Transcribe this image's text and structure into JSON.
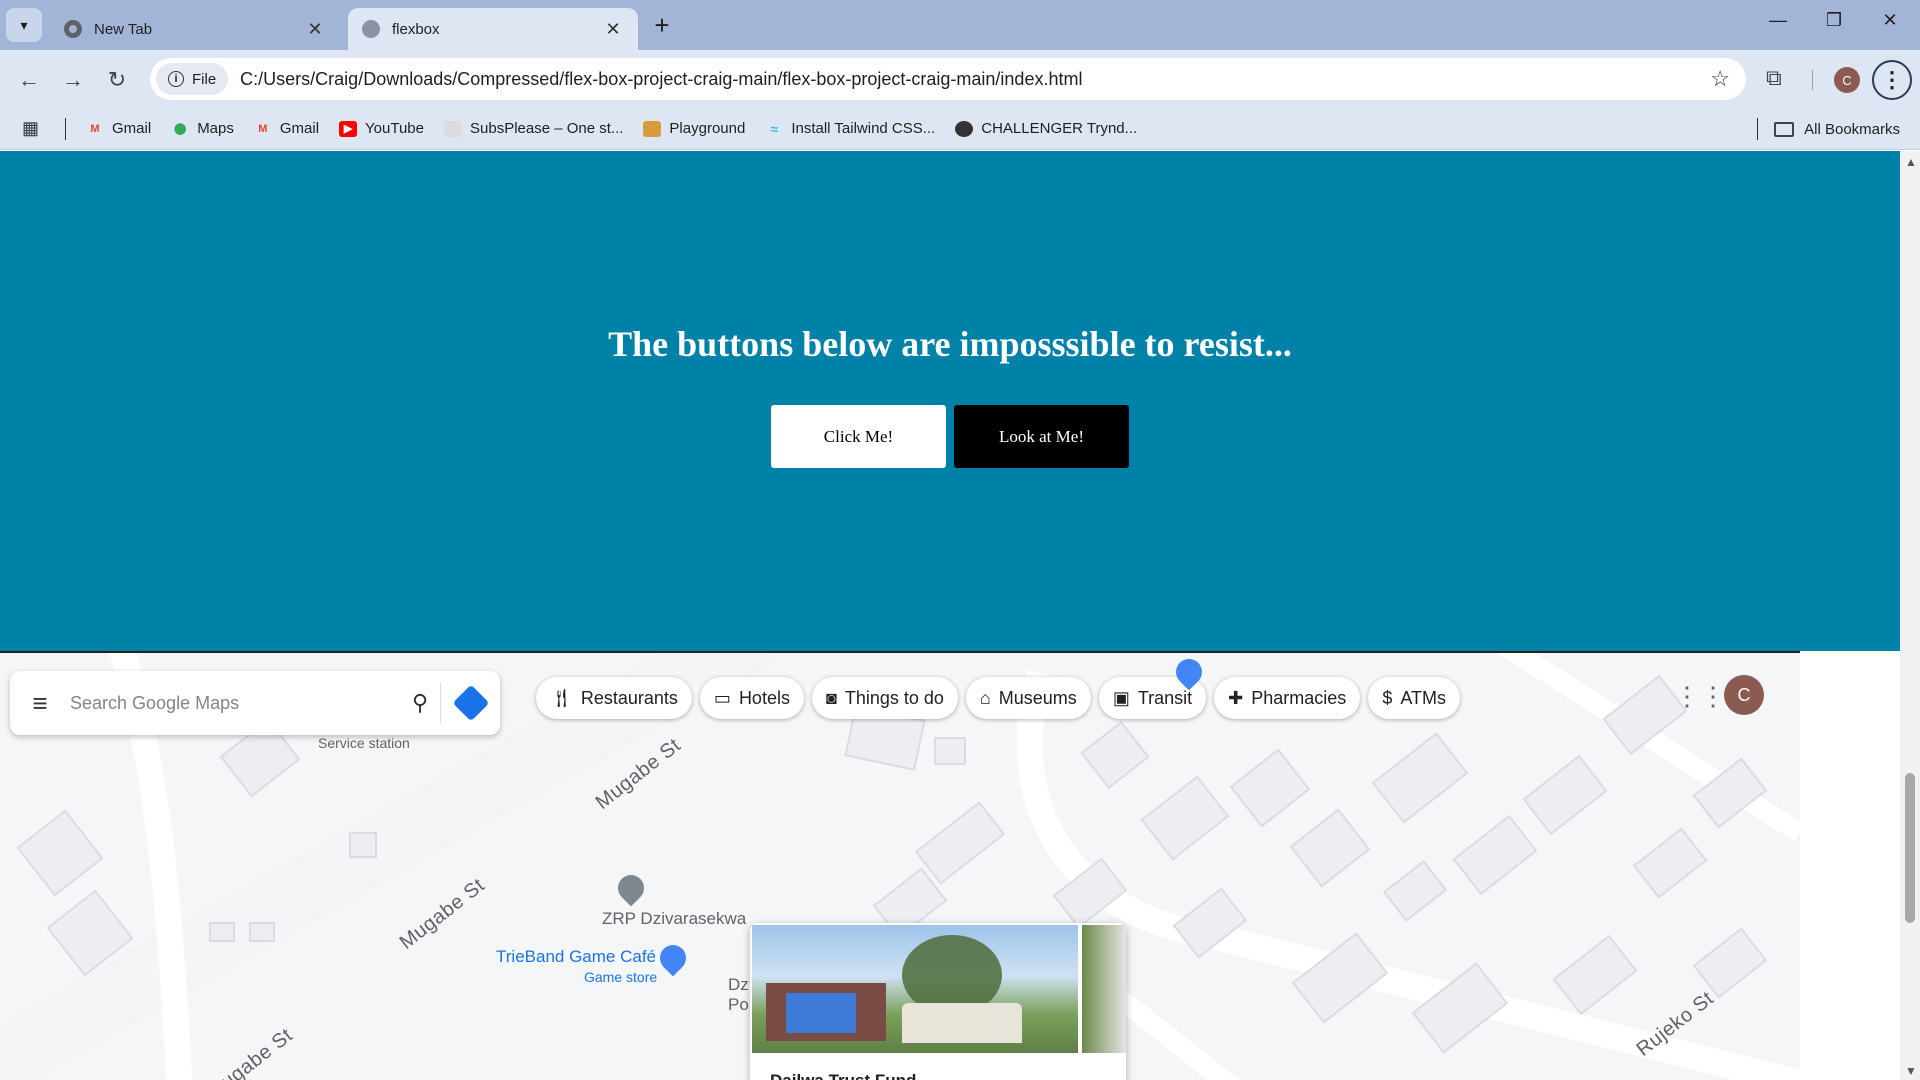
{
  "browser": {
    "tabs": [
      {
        "title": "New Tab",
        "active": false
      },
      {
        "title": "flexbox",
        "active": true
      }
    ],
    "address": {
      "chip": "File",
      "url": "C:/Users/Craig/Downloads/Compressed/flex-box-project-craig-main/flex-box-project-craig-main/index.html"
    },
    "profile_initial": "C",
    "bookmarks": [
      {
        "label": "Gmail",
        "icon": "gmail-icon",
        "color": "#ea4335"
      },
      {
        "label": "Maps",
        "icon": "maps-icon",
        "color": "#34a853"
      },
      {
        "label": "Gmail",
        "icon": "gmail-icon",
        "color": "#ea4335"
      },
      {
        "label": "YouTube",
        "icon": "youtube-icon",
        "color": "#ff0000"
      },
      {
        "label": "SubsPlease – One st...",
        "icon": "subsplease-icon",
        "color": "#bbbbbb"
      },
      {
        "label": "Playground",
        "icon": "playground-icon",
        "color": "#d99a3a"
      },
      {
        "label": "Install Tailwind CSS...",
        "icon": "tailwind-icon",
        "color": "#38bdf8"
      },
      {
        "label": "CHALLENGER Trynd...",
        "icon": "globe-icon",
        "color": "#333333"
      }
    ],
    "all_bookmarks": "All Bookmarks"
  },
  "page": {
    "heading": "The buttons below are imposssible to resist...",
    "buttons": {
      "click": "Click Me!",
      "look": "Look at Me!"
    },
    "hero_color": "#0081a7"
  },
  "map": {
    "search_placeholder": "Search Google Maps",
    "chips": [
      {
        "label": "Restaurants",
        "icon": "fork-knife-icon"
      },
      {
        "label": "Hotels",
        "icon": "bed-icon"
      },
      {
        "label": "Things to do",
        "icon": "camera-icon"
      },
      {
        "label": "Museums",
        "icon": "museum-icon"
      },
      {
        "label": "Transit",
        "icon": "bus-icon"
      },
      {
        "label": "Pharmacies",
        "icon": "pharmacy-icon"
      },
      {
        "label": "ATMs",
        "icon": "atm-icon"
      }
    ],
    "avatar_initial": "C",
    "streets": {
      "mugabe_1": "Mugabe St",
      "mugabe_2": "Mugabe St",
      "mugabe_3": "Mugabe St",
      "rujeko": "Rujeko St"
    },
    "pois": {
      "zrp": "ZRP Dzivarasekwa",
      "trieband": "TrieBand Game Café",
      "trieband_sub": "Game store",
      "dz": "Dz",
      "po": "Po",
      "service_station": "Service station"
    },
    "card_title": "Dailwa Trust Fund"
  }
}
